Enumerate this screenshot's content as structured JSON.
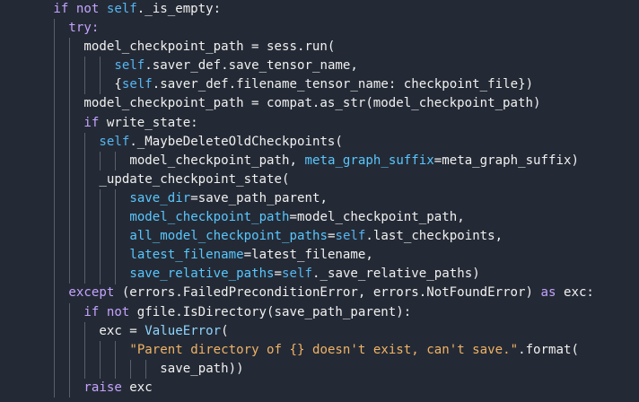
{
  "code_lines": [
    {
      "indent": 7,
      "tokens": [
        [
          "if not ",
          "kw"
        ],
        [
          "self",
          "self"
        ],
        [
          "._is_empty:",
          "plain"
        ]
      ]
    },
    {
      "indent": 9,
      "tokens": [
        [
          "try:",
          "kw"
        ]
      ]
    },
    {
      "indent": 11,
      "tokens": [
        [
          "model_checkpoint_path = sess.run(",
          "plain"
        ]
      ]
    },
    {
      "indent": 15,
      "tokens": [
        [
          "self",
          "self"
        ],
        [
          ".saver_def.save_tensor_name,",
          "plain"
        ]
      ]
    },
    {
      "indent": 15,
      "tokens": [
        [
          "{",
          "plain"
        ],
        [
          "self",
          "self"
        ],
        [
          ".saver_def.filename_tensor_name: checkpoint_file})",
          "plain"
        ]
      ]
    },
    {
      "indent": 11,
      "tokens": [
        [
          "model_checkpoint_path = compat.as_str(model_checkpoint_path)",
          "plain"
        ]
      ]
    },
    {
      "indent": 11,
      "tokens": [
        [
          "if ",
          "kw"
        ],
        [
          "write_state:",
          "plain"
        ]
      ]
    },
    {
      "indent": 13,
      "tokens": [
        [
          "self",
          "self"
        ],
        [
          "._MaybeDeleteOldCheckpoints(",
          "plain"
        ]
      ]
    },
    {
      "indent": 17,
      "tokens": [
        [
          "model_checkpoint_path, ",
          "plain"
        ],
        [
          "meta_graph_suffix",
          "arg"
        ],
        [
          "=meta_graph_suffix)",
          "plain"
        ]
      ]
    },
    {
      "indent": 13,
      "tokens": [
        [
          "_update_checkpoint_state(",
          "plain"
        ]
      ]
    },
    {
      "indent": 17,
      "tokens": [
        [
          "save_dir",
          "arg"
        ],
        [
          "=save_path_parent,",
          "plain"
        ]
      ]
    },
    {
      "indent": 17,
      "tokens": [
        [
          "model_checkpoint_path",
          "arg"
        ],
        [
          "=model_checkpoint_path,",
          "plain"
        ]
      ]
    },
    {
      "indent": 17,
      "tokens": [
        [
          "all_model_checkpoint_paths",
          "arg"
        ],
        [
          "=",
          "plain"
        ],
        [
          "self",
          "self"
        ],
        [
          ".last_checkpoints,",
          "plain"
        ]
      ]
    },
    {
      "indent": 17,
      "tokens": [
        [
          "latest_filename",
          "arg"
        ],
        [
          "=latest_filename,",
          "plain"
        ]
      ]
    },
    {
      "indent": 17,
      "tokens": [
        [
          "save_relative_paths",
          "arg"
        ],
        [
          "=",
          "plain"
        ],
        [
          "self",
          "self"
        ],
        [
          "._save_relative_paths)",
          "plain"
        ]
      ]
    },
    {
      "indent": 9,
      "tokens": [
        [
          "except ",
          "kw"
        ],
        [
          "(errors.FailedPreconditionError, errors.NotFoundError) ",
          "plain"
        ],
        [
          "as ",
          "kw"
        ],
        [
          "exc:",
          "plain"
        ]
      ]
    },
    {
      "indent": 11,
      "tokens": [
        [
          "if not ",
          "kw"
        ],
        [
          "gfile.IsDirectory(save_path_parent):",
          "plain"
        ]
      ]
    },
    {
      "indent": 13,
      "tokens": [
        [
          "exc = ",
          "plain"
        ],
        [
          "ValueError",
          "cls"
        ],
        [
          "(",
          "plain"
        ]
      ]
    },
    {
      "indent": 17,
      "tokens": [
        [
          "\"Parent directory of {} doesn't exist, can't save.\"",
          "str"
        ],
        [
          ".format(",
          "plain"
        ]
      ]
    },
    {
      "indent": 21,
      "tokens": [
        [
          "save_path))",
          "plain"
        ]
      ]
    },
    {
      "indent": 11,
      "tokens": [
        [
          "raise ",
          "kw"
        ],
        [
          "exc",
          "plain"
        ]
      ]
    }
  ],
  "colors": {
    "background": "#242a35",
    "keyword": "#c4a3ff",
    "self": "#56b6f2",
    "string": "#f0b366",
    "class": "#8fd5ff",
    "argument": "#58c7ff",
    "text": "#f0f0f0",
    "indent_guide": "#5a606b"
  }
}
